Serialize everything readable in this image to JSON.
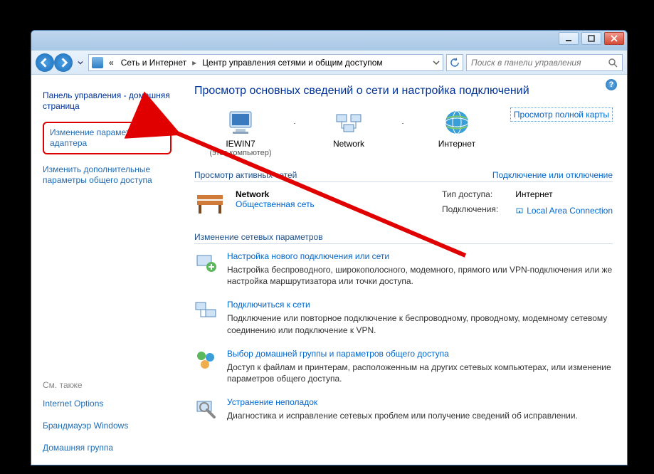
{
  "window_buttons": {
    "minimize": "Свернуть",
    "maximize": "Развернуть",
    "close": "Закрыть"
  },
  "breadcrumb": {
    "prefix": "«",
    "seg1": "Сеть и Интернет",
    "seg2": "Центр управления сетями и общим доступом"
  },
  "search": {
    "placeholder": "Поиск в панели управления"
  },
  "sidebar": {
    "home": "Панель управления - домашняя страница",
    "adapter": "Изменение параметров адаптера",
    "sharing": "Изменить дополнительные параметры общего доступа",
    "see_also_header": "См. также",
    "see_also": {
      "inetopt": "Internet Options",
      "firewall": "Брандмауэр Windows",
      "homegroup": "Домашняя группа"
    }
  },
  "main": {
    "heading": "Просмотр основных сведений о сети и настройка подключений",
    "map_link": "Просмотр полной карты",
    "nodes": {
      "pc": {
        "label": "IEWIN7",
        "sub": "(этот компьютер)"
      },
      "net": {
        "label": "Network"
      },
      "inet": {
        "label": "Интернет"
      }
    },
    "active_section": {
      "title": "Просмотр активных сетей",
      "connect_link": "Подключение или отключение"
    },
    "active_net": {
      "name": "Network",
      "type": "Общественная сеть",
      "access_k": "Тип доступа:",
      "access_v": "Интернет",
      "conn_k": "Подключения:",
      "conn_v": "Local Area Connection"
    },
    "change_section": "Изменение сетевых параметров",
    "items": [
      {
        "title": "Настройка нового подключения или сети",
        "desc": "Настройка беспроводного, широкополосного, модемного, прямого или VPN-подключения или же настройка маршрутизатора или точки доступа."
      },
      {
        "title": "Подключиться к сети",
        "desc": "Подключение или повторное подключение к беспроводному, проводному, модемному сетевому соединению или подключение к VPN."
      },
      {
        "title": "Выбор домашней группы и параметров общего доступа",
        "desc": "Доступ к файлам и принтерам, расположенным на других сетевых компьютерах, или изменение параметров общего доступа."
      },
      {
        "title": "Устранение неполадок",
        "desc": "Диагностика и исправление сетевых проблем или получение сведений об исправлении."
      }
    ]
  }
}
